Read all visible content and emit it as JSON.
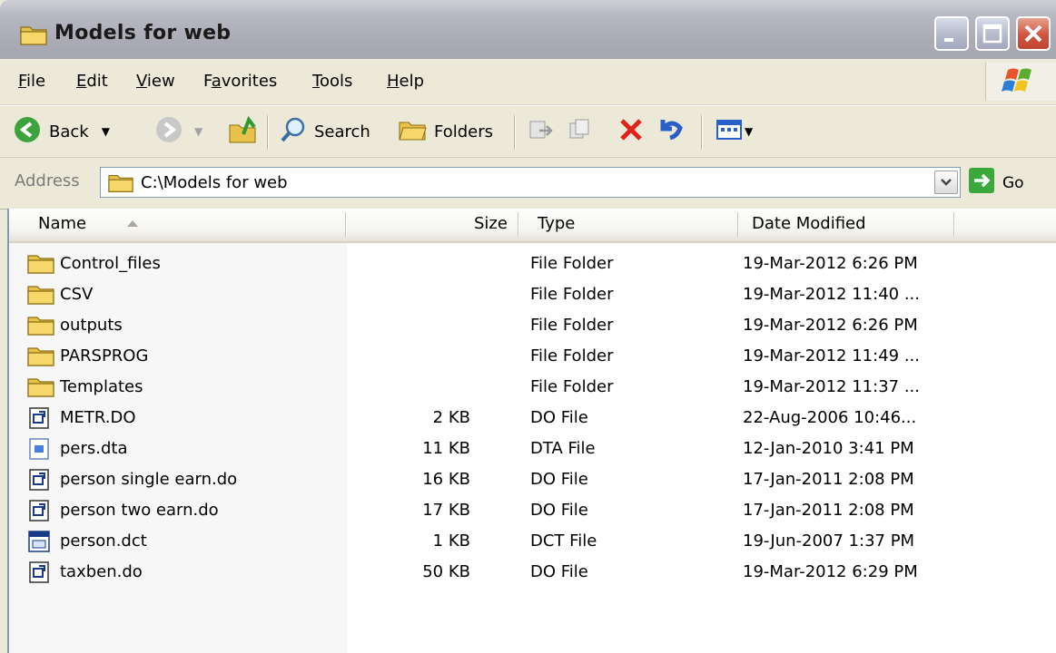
{
  "window": {
    "title": "Models for web",
    "title_icon": "folder-icon",
    "controls": [
      "minimize-icon",
      "maximize-icon",
      "close-icon"
    ]
  },
  "menubar": {
    "items": [
      {
        "label": "File",
        "accel": "F"
      },
      {
        "label": "Edit",
        "accel": "E"
      },
      {
        "label": "View",
        "accel": "V"
      },
      {
        "label": "Favorites",
        "accel": "a"
      },
      {
        "label": "Tools",
        "accel": "T"
      },
      {
        "label": "Help",
        "accel": "H"
      }
    ]
  },
  "toolbar": {
    "back_label": "Back",
    "search_label": "Search",
    "folders_label": "Folders"
  },
  "address": {
    "label": "Address",
    "value": "C:\\Models for web",
    "go_label": "Go"
  },
  "columns": {
    "name": "Name",
    "size": "Size",
    "type": "Type",
    "date": "Date Modified"
  },
  "files": [
    {
      "name": "Control_files",
      "size": "",
      "type": "File Folder",
      "date": "19-Mar-2012 6:26 PM",
      "icon": "folder-icon"
    },
    {
      "name": "CSV",
      "size": "",
      "type": "File Folder",
      "date": "19-Mar-2012 11:40 ...",
      "icon": "folder-icon"
    },
    {
      "name": "outputs",
      "size": "",
      "type": "File Folder",
      "date": "19-Mar-2012 6:26 PM",
      "icon": "folder-icon"
    },
    {
      "name": "PARSPROG",
      "size": "",
      "type": "File Folder",
      "date": "19-Mar-2012 11:49 ...",
      "icon": "folder-icon"
    },
    {
      "name": "Templates",
      "size": "",
      "type": "File Folder",
      "date": "19-Mar-2012 11:37 ...",
      "icon": "folder-icon"
    },
    {
      "name": "METR.DO",
      "size": "2 KB",
      "type": "DO File",
      "date": "22-Aug-2006 10:46...",
      "icon": "do-file-icon"
    },
    {
      "name": "pers.dta",
      "size": "11 KB",
      "type": "DTA File",
      "date": "12-Jan-2010 3:41 PM",
      "icon": "dta-file-icon"
    },
    {
      "name": "person single earn.do",
      "size": "16 KB",
      "type": "DO File",
      "date": "17-Jan-2011 2:08 PM",
      "icon": "do-file-icon"
    },
    {
      "name": "person two earn.do",
      "size": "17 KB",
      "type": "DO File",
      "date": "17-Jan-2011 2:08 PM",
      "icon": "do-file-icon"
    },
    {
      "name": "person.dct",
      "size": "1 KB",
      "type": "DCT File",
      "date": "19-Jun-2007 1:37 PM",
      "icon": "dct-file-icon"
    },
    {
      "name": "taxben.do",
      "size": "50 KB",
      "type": "DO File",
      "date": "19-Mar-2012 6:29 PM",
      "icon": "do-file-icon"
    }
  ]
}
